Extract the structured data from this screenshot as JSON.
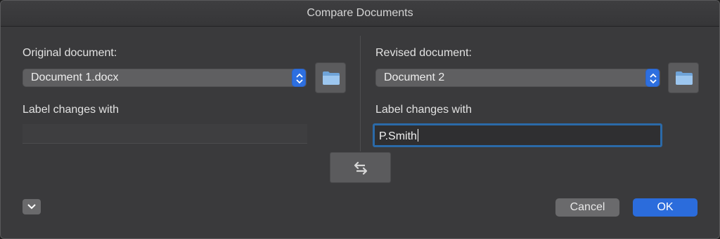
{
  "window": {
    "title": "Compare Documents"
  },
  "original": {
    "heading": "Original document:",
    "selected_document": "Document 1.docx",
    "label_changes_heading": "Label changes with",
    "label_value": ""
  },
  "revised": {
    "heading": "Revised document:",
    "selected_document": "Document 2",
    "label_changes_heading": "Label changes with",
    "label_value": "P.Smith"
  },
  "buttons": {
    "cancel": "Cancel",
    "ok": "OK"
  },
  "icons": {
    "original_browse": "folder-icon",
    "revised_browse": "folder-icon",
    "swap": "swap-arrows-icon",
    "more_options": "chevron-down-icon",
    "select_stepper": "up-down-chevron-icon"
  },
  "colors": {
    "accent": "#2d6fe0",
    "focus_ring": "#2b6aa8",
    "dialog_bg": "#3a3a3c"
  }
}
